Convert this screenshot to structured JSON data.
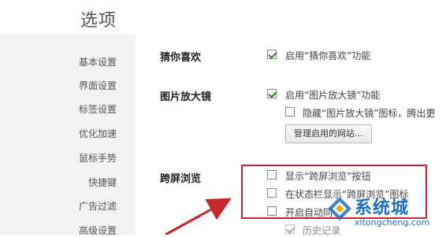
{
  "header": {
    "title": "选项"
  },
  "sidebar": {
    "items": [
      {
        "label": "基本设置"
      },
      {
        "label": "界面设置"
      },
      {
        "label": "标签设置"
      },
      {
        "label": "优化加速"
      },
      {
        "label": "鼠标手势"
      },
      {
        "label": "快捷键"
      },
      {
        "label": "广告过滤"
      },
      {
        "label": "高级设置"
      }
    ]
  },
  "sections": {
    "guess": {
      "title": "猜你喜欢",
      "options": [
        {
          "label": "启用“猜你喜欢”功能",
          "checked": true
        }
      ]
    },
    "magnifier": {
      "title": "图片放大镜",
      "options": [
        {
          "label": "启用“图片放大镜”功能",
          "checked": true
        },
        {
          "label": "隐藏“图片放大镜”图标，腾出更",
          "checked": false
        }
      ],
      "manage_button": "管理启用的网站..."
    },
    "crossscreen": {
      "title": "跨屏浏览",
      "options": [
        {
          "label": "显示“跨屏浏览”按钮",
          "checked": false
        },
        {
          "label": "在状态栏显示“跨屏浏览”图标",
          "checked": false
        },
        {
          "label": "开启自动同",
          "checked": false
        },
        {
          "label": "历史记录",
          "checked": true
        }
      ]
    }
  },
  "watermark": {
    "brand": "系统城",
    "domain": "xitongcheng.com"
  },
  "colors": {
    "annotation": "#c6262e",
    "check": "#2b7d2b",
    "watermark": "#1d6fc0"
  }
}
